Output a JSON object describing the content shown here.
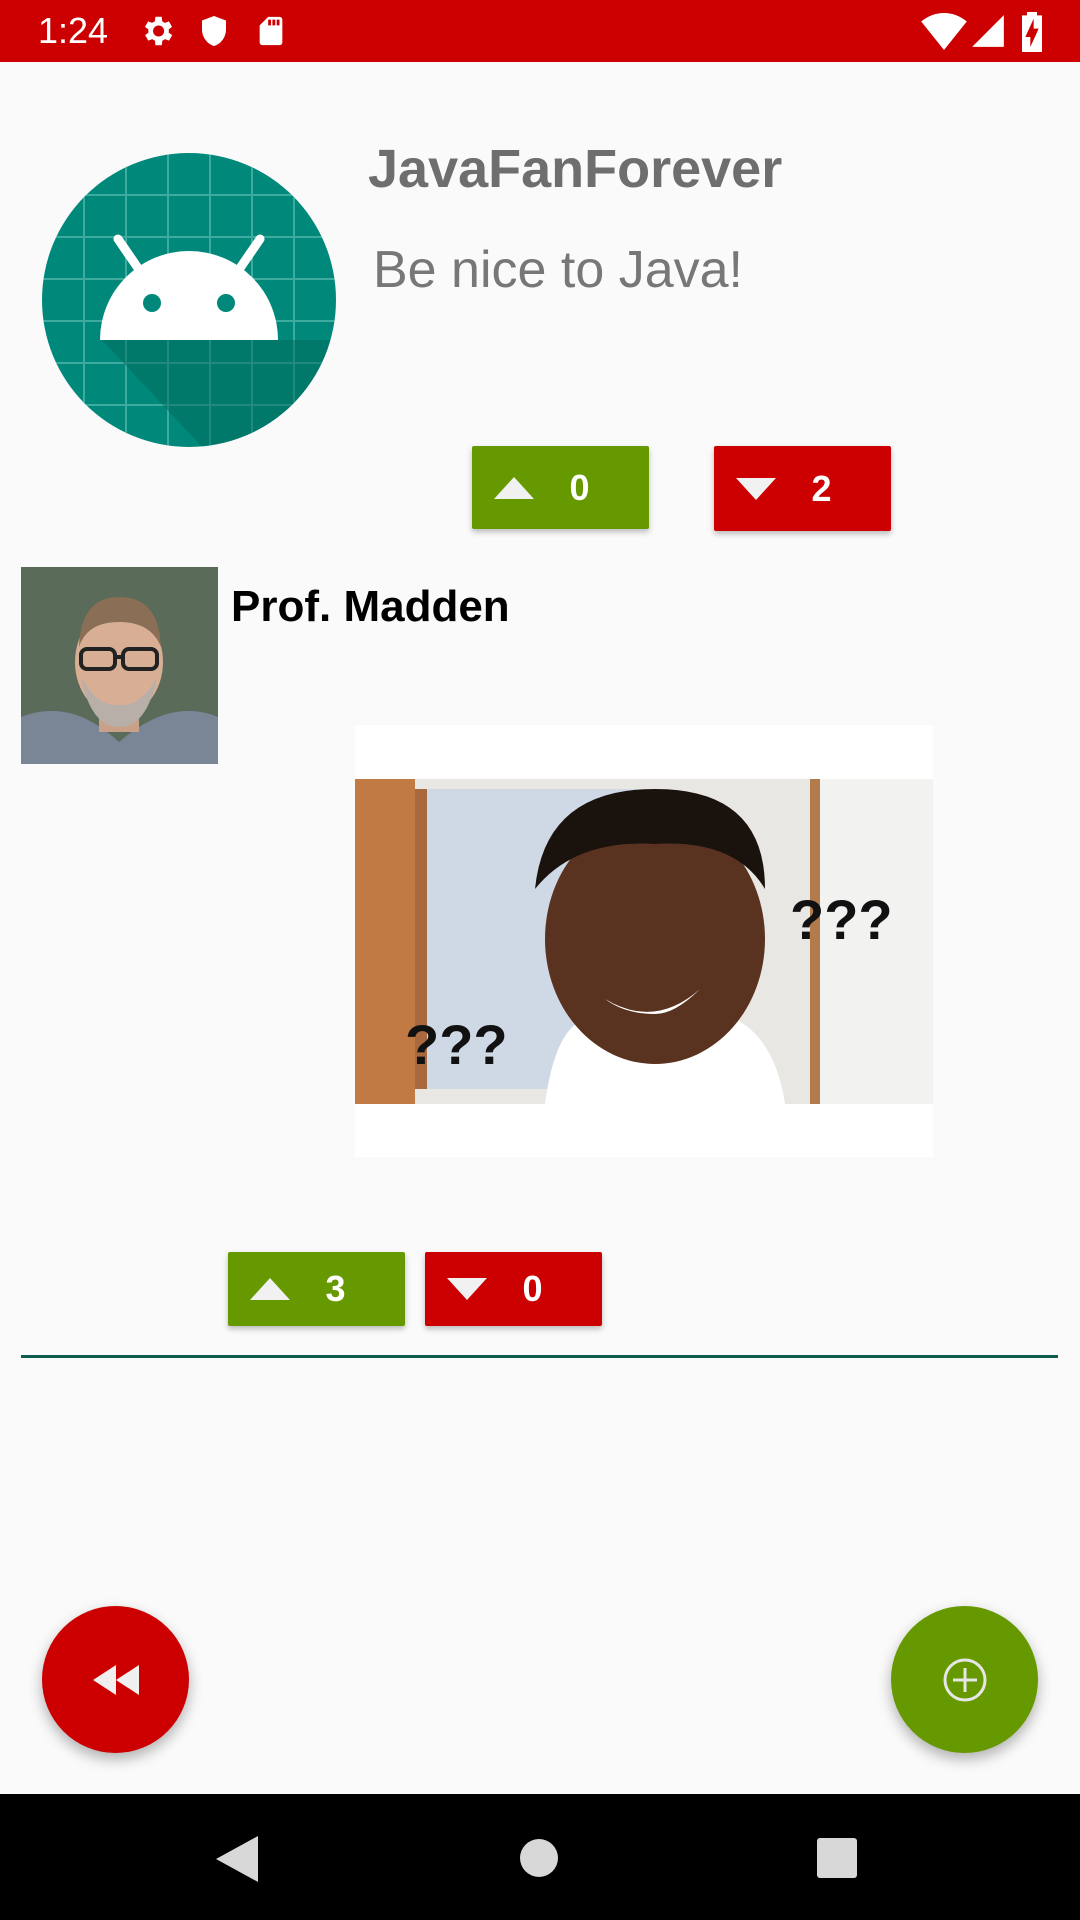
{
  "status_bar": {
    "time": "1:24",
    "left_icons": [
      "gear-icon",
      "shield-icon",
      "sd-card-icon"
    ],
    "right_icons": [
      "wifi-icon",
      "signal-icon",
      "battery-charging-icon"
    ],
    "color": "#cc0000"
  },
  "header": {
    "title": "JavaFanForever",
    "subtitle": "Be nice to Java!",
    "upvotes": "0",
    "downvotes": "2"
  },
  "post": {
    "author": "Prof. Madden",
    "image_overlay_text": [
      "???",
      "???"
    ],
    "upvotes": "3",
    "downvotes": "0"
  },
  "fab": {
    "back_icon": "rewind-icon",
    "add_icon": "add-circle-icon"
  },
  "nav_bar": {
    "icons": [
      "back-triangle-icon",
      "home-circle-icon",
      "recents-square-icon"
    ]
  },
  "colors": {
    "accent_red": "#cc0000",
    "accent_green": "#669900",
    "divider": "#0d5d4f",
    "avatar_teal": "#00897b"
  }
}
